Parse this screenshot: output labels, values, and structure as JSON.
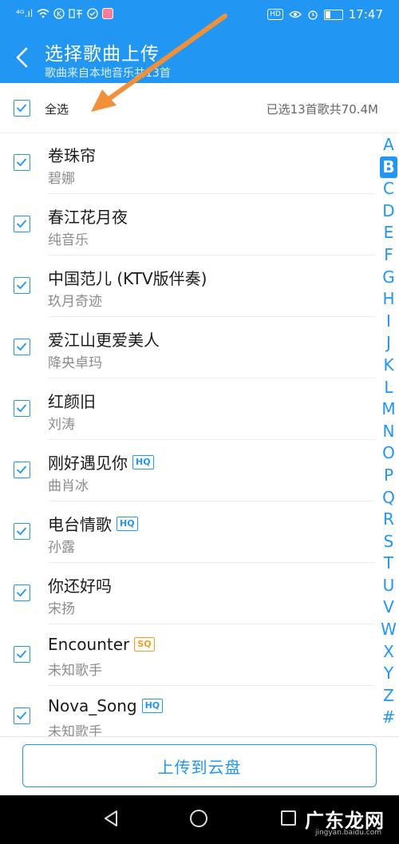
{
  "status_bar": {
    "signal": "⁴ᴳ.ıl",
    "wifi": "◠",
    "right_box": "HD",
    "time": "17:47"
  },
  "header": {
    "title": "选择歌曲上传",
    "subtitle": "歌曲来自本地音乐共13首"
  },
  "select_all": {
    "label": "全选",
    "summary": "已选13首歌共70.4M"
  },
  "songs": [
    {
      "title": "卷珠帘",
      "artist": "碧娜",
      "badge": ""
    },
    {
      "title": "春江花月夜",
      "artist": "纯音乐",
      "badge": ""
    },
    {
      "title": "中国范儿 (KTV版伴奏)",
      "artist": "玖月奇迹",
      "badge": ""
    },
    {
      "title": "爱江山更爱美人",
      "artist": "降央卓玛",
      "badge": ""
    },
    {
      "title": "红颜旧",
      "artist": "刘涛",
      "badge": ""
    },
    {
      "title": "刚好遇见你",
      "artist": "曲肖冰",
      "badge": "HQ"
    },
    {
      "title": "电台情歌",
      "artist": "孙露",
      "badge": "HQ"
    },
    {
      "title": "你还好吗",
      "artist": "宋扬",
      "badge": ""
    },
    {
      "title": "Encounter",
      "artist": "未知歌手",
      "badge": "SQ"
    },
    {
      "title": "Nova_Song",
      "artist": "未知歌手",
      "badge": "HQ"
    }
  ],
  "alphabet_index": [
    "A",
    "B",
    "C",
    "D",
    "E",
    "F",
    "G",
    "H",
    "I",
    "J",
    "K",
    "L",
    "M",
    "N",
    "O",
    "P",
    "Q",
    "R",
    "S",
    "T",
    "U",
    "V",
    "W",
    "X",
    "Y",
    "Z",
    "#"
  ],
  "alphabet_active": "B",
  "upload_button": {
    "label": "上传到云盘"
  },
  "watermark": {
    "text": "广东龙网",
    "sub": "jingyan.baidu.com"
  },
  "colors": {
    "accent": "#2196f3",
    "arrow": "#f0913a",
    "hq": "#2196f3",
    "sq": "#f0a020"
  }
}
